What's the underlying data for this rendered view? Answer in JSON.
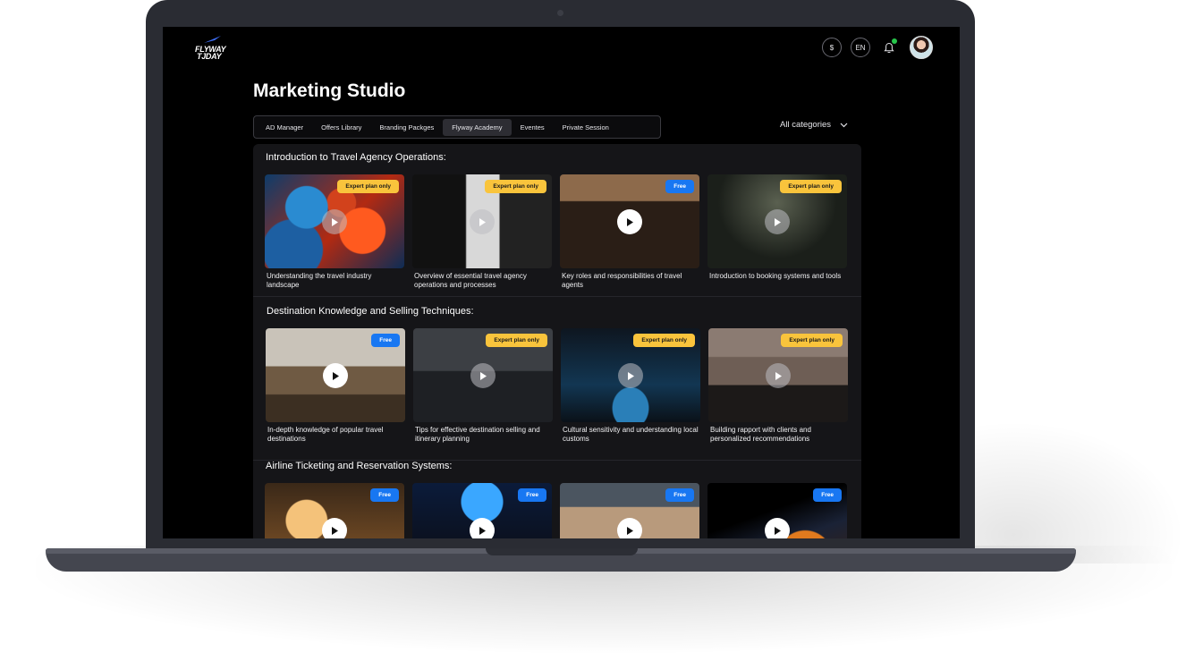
{
  "app": {
    "logo_line1": "FLYWAY",
    "logo_line2": "TJDAY",
    "page_title": "Marketing Studio"
  },
  "topbar": {
    "currency_label": "$",
    "language_label": "EN"
  },
  "tabs": [
    {
      "label": "AD Manager",
      "active": false
    },
    {
      "label": "Offers Library",
      "active": false
    },
    {
      "label": "Branding Packges",
      "active": false
    },
    {
      "label": "Flyway Academy",
      "active": true
    },
    {
      "label": "Eventes",
      "active": false
    },
    {
      "label": "Private Session",
      "active": false
    }
  ],
  "category_filter": {
    "selected": "All categories"
  },
  "sections": [
    {
      "title": "Introduction to Travel Agency Operations:",
      "cards": [
        {
          "badge": "Expert plan only",
          "badge_type": "expert",
          "title": "Understanding the travel industry landscape"
        },
        {
          "badge": "Expert plan only",
          "badge_type": "expert",
          "title": "Overview of essential travel agency operations and processes"
        },
        {
          "badge": "Free",
          "badge_type": "free",
          "title": "Key roles and responsibilities of travel agents"
        },
        {
          "badge": "Expert plan only",
          "badge_type": "expert",
          "title": "Introduction to booking systems and tools"
        }
      ]
    },
    {
      "title": "Destination Knowledge and Selling Techniques:",
      "cards": [
        {
          "badge": "Free",
          "badge_type": "free",
          "title": "In-depth knowledge of popular travel destinations"
        },
        {
          "badge": "Expert plan only",
          "badge_type": "expert",
          "title": "Tips for effective destination selling and itinerary planning"
        },
        {
          "badge": "Expert plan only",
          "badge_type": "expert",
          "title": "Cultural sensitivity and understanding local customs"
        },
        {
          "badge": "Expert plan only",
          "badge_type": "expert",
          "title": "Building rapport with clients and personalized recommendations"
        }
      ]
    },
    {
      "title": "Airline Ticketing and Reservation Systems:",
      "cards": [
        {
          "badge": "Free",
          "badge_type": "free",
          "title": ""
        },
        {
          "badge": "Free",
          "badge_type": "free",
          "title": ""
        },
        {
          "badge": "Free",
          "badge_type": "free",
          "title": ""
        },
        {
          "badge": "Free",
          "badge_type": "free",
          "title": ""
        }
      ]
    }
  ],
  "colors": {
    "expert_badge": "#f9c43c",
    "free_badge": "#1877f2",
    "notification_dot": "#27c64b"
  }
}
